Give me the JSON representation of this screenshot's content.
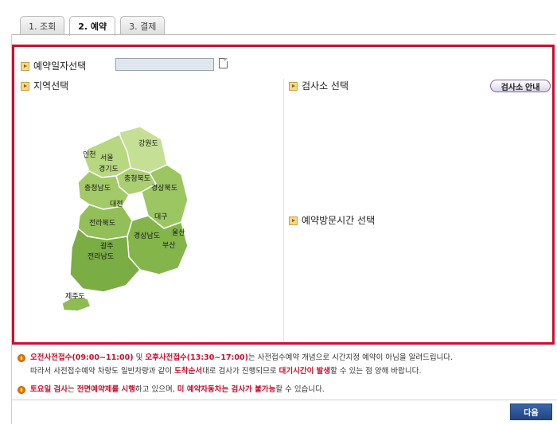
{
  "tabs": [
    {
      "label": "1. 조회",
      "active": false
    },
    {
      "label": "2. 예약",
      "active": true
    },
    {
      "label": "3. 결제",
      "active": false
    }
  ],
  "form": {
    "date_label": "예약일자선택",
    "date_value": "",
    "region_label": "지역선택",
    "center_label": "검사소 선택",
    "center_guide_button": "검사소 안내",
    "time_label": "예약방문시간 선택"
  },
  "map": {
    "regions": [
      "강원도",
      "인천",
      "서울",
      "경기도",
      "충청북도",
      "충청남도",
      "경상북도",
      "대전",
      "대구",
      "전라북도",
      "경상남도",
      "울산",
      "광주",
      "전라남도",
      "부산",
      "제주도"
    ],
    "colors": {
      "fill_light": "#b7d67f",
      "fill_dark": "#7fae45",
      "border": "#ffffff"
    }
  },
  "notices": {
    "line1": {
      "a": "오전사전접수(09:00~11:00)",
      "b": " 및 ",
      "c": "오후사전접수(13:30~17:00)",
      "d": "는 사전접수예약 개념으로 시간지정 예약이 아님을 알려드립니다."
    },
    "line2": {
      "a": "따라서 사전접수예약 차량도 일반차량과 같이 ",
      "b": "도착순서",
      "c": "대로 검사가 진행되므로 ",
      "d": "대기시간이 발생",
      "e": "할 수 있는 점 양해 바랍니다."
    },
    "line3": {
      "a": "토요일 검사",
      "b": "는 ",
      "c": "전면예약제를 시행",
      "d": "하고 있으며, ",
      "e": "미 예약자동차는 검사가 불가능",
      "f": "할 수 있습니다."
    }
  },
  "footer": {
    "next_label": "다음"
  },
  "colors": {
    "accent_red": "#c8102e",
    "button_blue": "#1f4585"
  }
}
